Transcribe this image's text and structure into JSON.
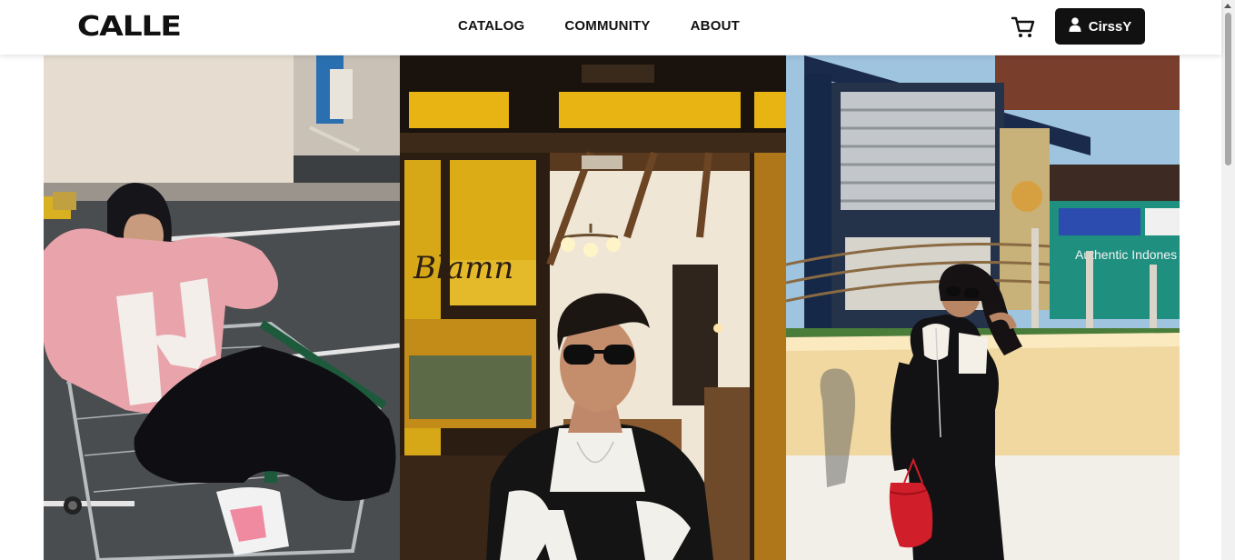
{
  "header": {
    "logo": "CALLE",
    "nav": [
      {
        "label": "CATALOG"
      },
      {
        "label": "COMMUNITY"
      },
      {
        "label": "ABOUT"
      }
    ],
    "cart_icon": "shopping-cart-icon",
    "user": {
      "name": "CirssY",
      "icon": "user-icon"
    }
  },
  "gallery": {
    "photos": [
      {
        "name": "photo-woman-pink-hoodie-cart"
      },
      {
        "name": "photo-man-sunglasses-restaurant"
      },
      {
        "name": "photo-woman-black-jacket-red-bag",
        "sign_text": "Authentic Indones"
      }
    ]
  },
  "colors": {
    "primary": "#111111",
    "hoodie_pink": "#e8a4aa",
    "bag_red": "#d01e2a",
    "wall_yellow": "#f0d8a0"
  }
}
